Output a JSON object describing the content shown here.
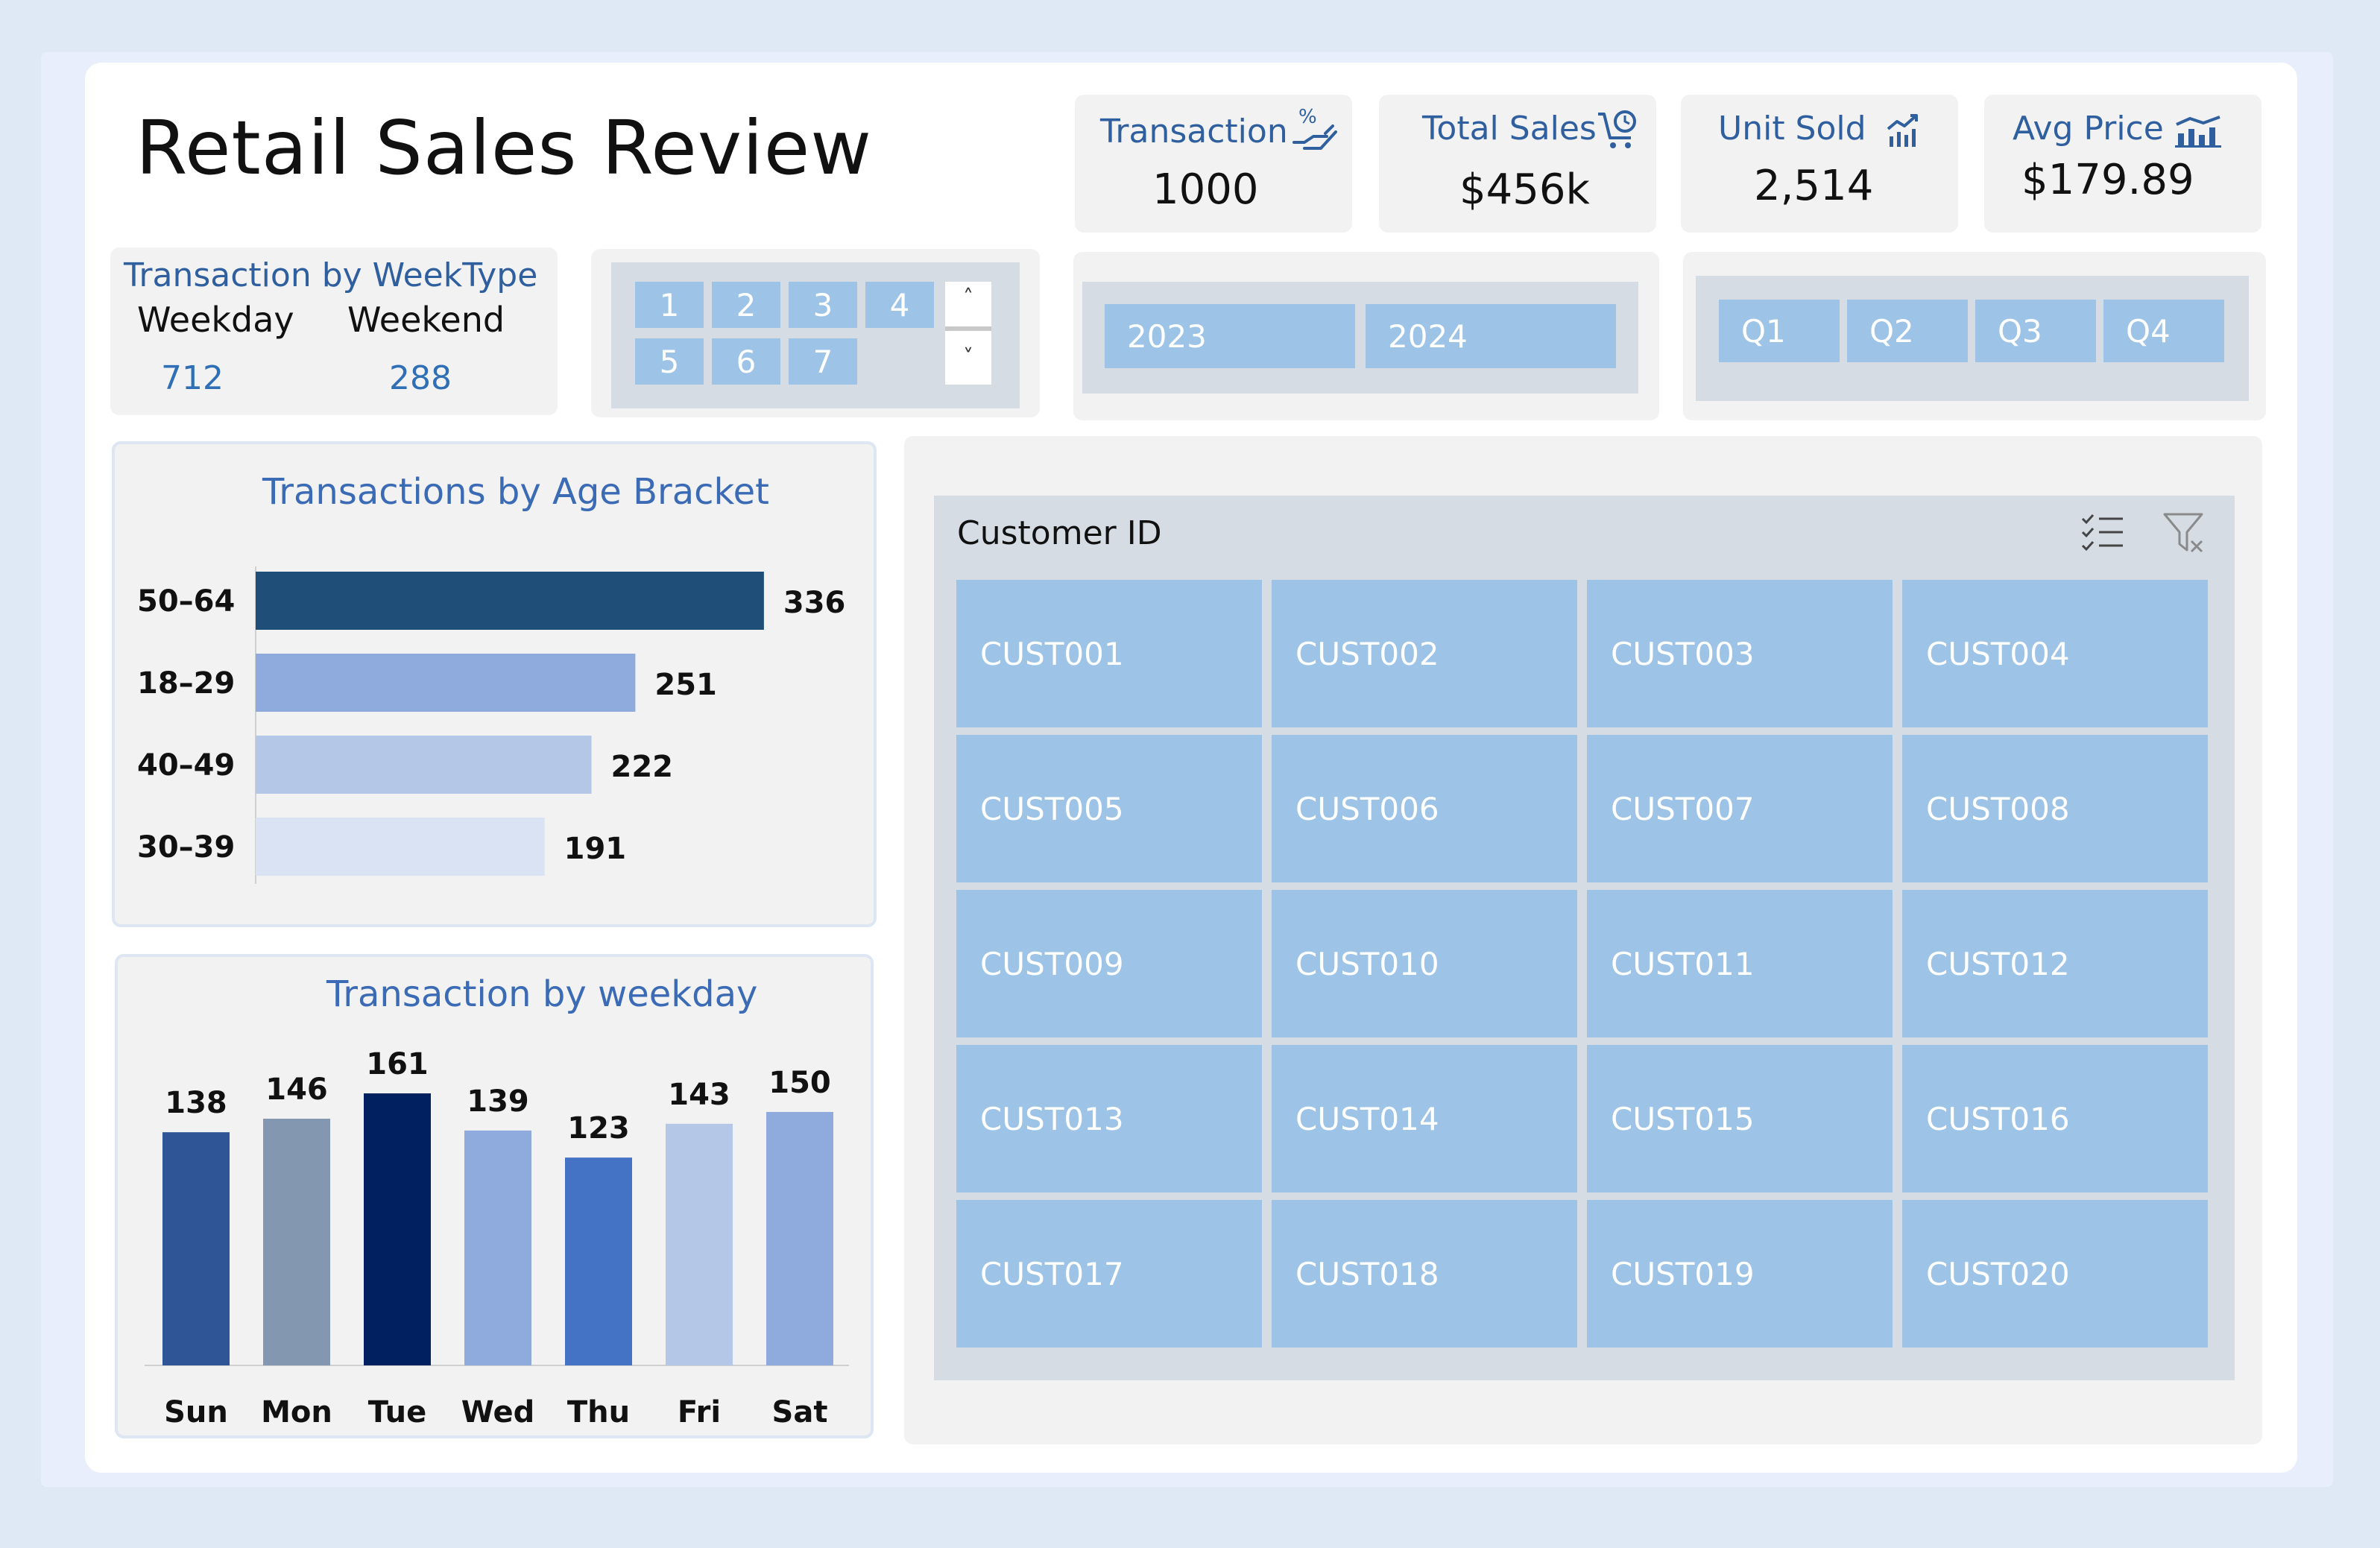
{
  "header": {
    "title": "Retail Sales Review"
  },
  "kpis": [
    {
      "label": "Transaction",
      "value": "1000",
      "icon": "percent-hand-icon"
    },
    {
      "label": "Total Sales",
      "value": "$456k",
      "icon": "cart-clock-icon"
    },
    {
      "label": "Unit Sold",
      "value": "2,514",
      "icon": "growth-chart-icon"
    },
    {
      "label": "Avg Price",
      "value": "$179.89",
      "icon": "bar-chart-icon"
    }
  ],
  "weektype": {
    "title_part1": "Transaction",
    "title_part2": "by WeekType",
    "weekday_label": "Weekday",
    "weekend_label": "Weekend",
    "weekday_value": "712",
    "weekend_value": "288"
  },
  "day_slicer": {
    "items": [
      "1",
      "2",
      "3",
      "4",
      "5",
      "6",
      "7"
    ],
    "scroll_up": "˄",
    "scroll_down": "˅"
  },
  "year_slicer": {
    "items": [
      "2023",
      "2024"
    ]
  },
  "quarter_slicer": {
    "items": [
      "Q1",
      "Q2",
      "Q3",
      "Q4"
    ]
  },
  "customer_slicer": {
    "title": "Customer ID",
    "items": [
      "CUST001",
      "CUST002",
      "CUST003",
      "CUST004",
      "CUST005",
      "CUST006",
      "CUST007",
      "CUST008",
      "CUST009",
      "CUST010",
      "CUST011",
      "CUST012",
      "CUST013",
      "CUST014",
      "CUST015",
      "CUST016",
      "CUST017",
      "CUST018",
      "CUST019",
      "CUST020"
    ]
  },
  "chart_data": [
    {
      "type": "bar",
      "orientation": "horizontal",
      "title": "Transactions by Age Bracket",
      "categories": [
        "50–64",
        "18–29",
        "40–49",
        "30–39"
      ],
      "values": [
        336,
        251,
        222,
        191
      ],
      "colors": [
        "#1f4e79",
        "#8faadc",
        "#b4c7e7",
        "#dae3f3"
      ],
      "grid": false
    },
    {
      "type": "bar",
      "orientation": "vertical",
      "title": "Transaction by weekday",
      "categories": [
        "Sun",
        "Mon",
        "Tue",
        "Wed",
        "Thu",
        "Fri",
        "Sat"
      ],
      "values": [
        138,
        146,
        161,
        139,
        123,
        143,
        150
      ],
      "colors": [
        "#2f5597",
        "#8497b0",
        "#002060",
        "#8faadc",
        "#4472c4",
        "#b4c7e7",
        "#8faadc"
      ],
      "grid": false
    }
  ]
}
